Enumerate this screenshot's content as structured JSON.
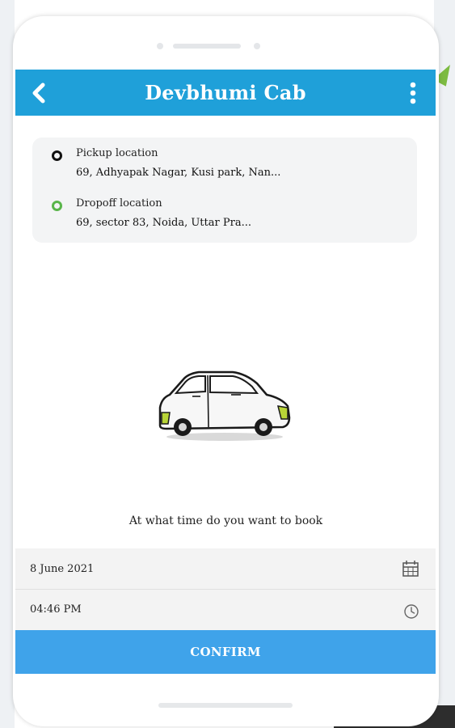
{
  "app_bar": {
    "title": "Devbhumi Cab",
    "back_icon": "chevron-left-icon",
    "menu_icon": "more-vertical-icon",
    "color": "#1fa0d9"
  },
  "locations": {
    "pickup": {
      "label": "Pickup location",
      "address": "69, Adhyapak Nagar, Kusi park, Nan...",
      "marker_color": "#111111"
    },
    "dropoff": {
      "label": "Dropoff location",
      "address": "69, sector 83, Noida, Uttar Pra...",
      "marker_color": "#59b54a"
    }
  },
  "illustration": "car-icon",
  "booking": {
    "prompt": "At what time do you want to book",
    "date_value": "8 June 2021",
    "date_icon": "calendar-icon",
    "time_value": "04:46 PM",
    "time_icon": "clock-icon"
  },
  "confirm_button": {
    "label": "CONFIRM",
    "color": "#3fa3ea"
  }
}
